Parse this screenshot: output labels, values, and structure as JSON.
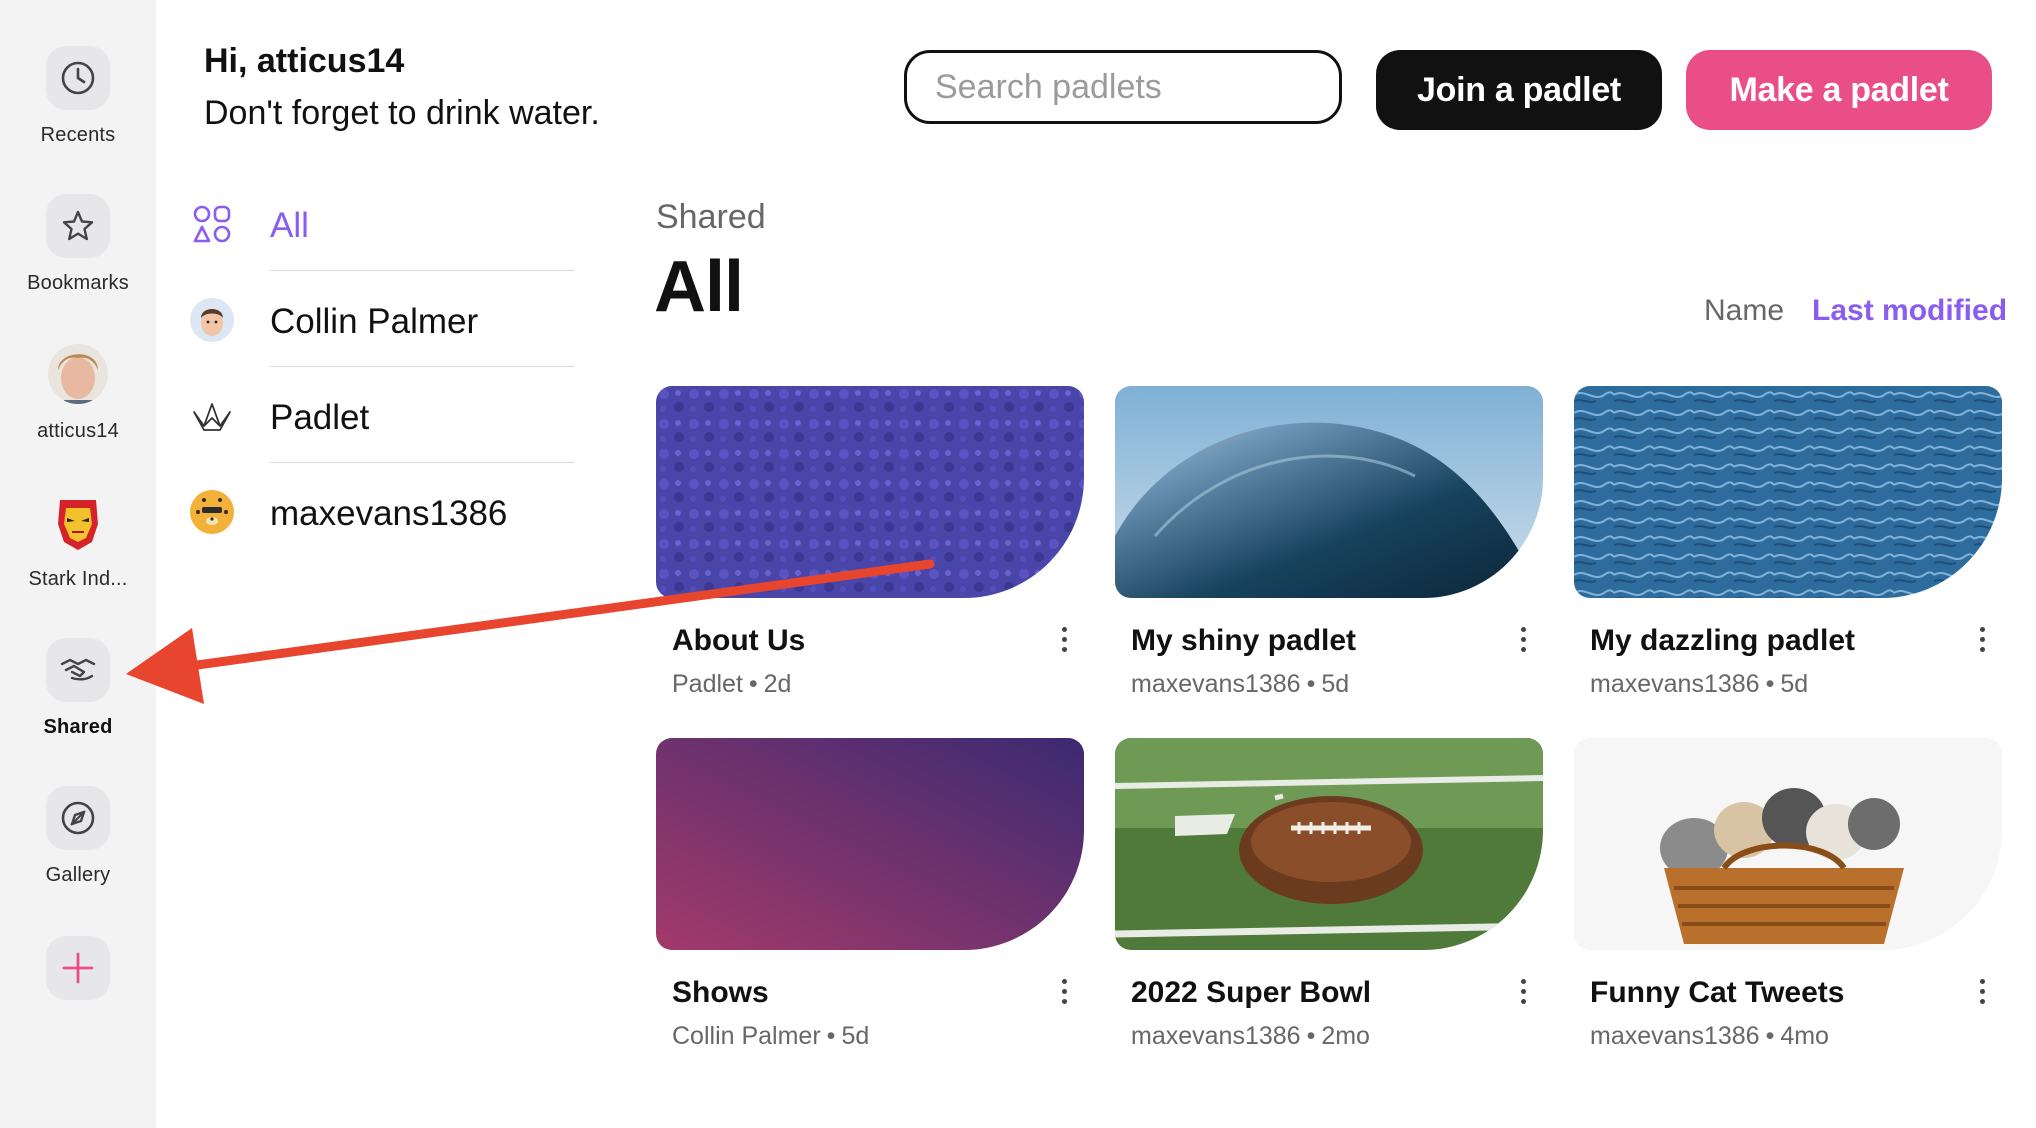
{
  "rail": {
    "items": [
      {
        "label": "Recents",
        "icon": "clock-icon"
      },
      {
        "label": "Bookmarks",
        "icon": "star-icon"
      },
      {
        "label": "atticus14",
        "icon": "user-avatar"
      },
      {
        "label": "Stark Ind...",
        "icon": "iron-man-avatar"
      },
      {
        "label": "Shared",
        "icon": "handshake-icon"
      },
      {
        "label": "Gallery",
        "icon": "compass-icon"
      }
    ],
    "add_icon": "plus-icon"
  },
  "header": {
    "greeting": "Hi, atticus14",
    "subtitle": "Don't forget to drink water.",
    "search_placeholder": "Search padlets",
    "join_label": "Join a padlet",
    "make_label": "Make a padlet"
  },
  "filters": [
    {
      "label": "All",
      "icon": "grid-shapes-icon"
    },
    {
      "label": "Collin Palmer",
      "icon": "memoji-avatar"
    },
    {
      "label": "Padlet",
      "icon": "padlet-logo-icon"
    },
    {
      "label": "maxevans1386",
      "icon": "cheetah-avatar"
    }
  ],
  "section": {
    "eyebrow": "Shared",
    "title": "All",
    "sort_name": "Name",
    "sort_last_modified": "Last modified"
  },
  "cards": [
    {
      "title": "About Us",
      "owner": "Padlet",
      "age": "2d"
    },
    {
      "title": "My shiny padlet",
      "owner": "maxevans1386",
      "age": "5d"
    },
    {
      "title": "My dazzling padlet",
      "owner": "maxevans1386",
      "age": "5d"
    },
    {
      "title": "Shows",
      "owner": "Collin Palmer",
      "age": "5d"
    },
    {
      "title": "2022 Super Bowl",
      "owner": "maxevans1386",
      "age": "2mo"
    },
    {
      "title": "Funny Cat Tweets",
      "owner": "maxevans1386",
      "age": "4mo"
    }
  ],
  "meta_separator": "•",
  "colors": {
    "accent_purple": "#8a5cf0",
    "make_button_pink": "#e94f86",
    "join_button_black": "#111111",
    "annotation_arrow_red": "#e8452f"
  }
}
